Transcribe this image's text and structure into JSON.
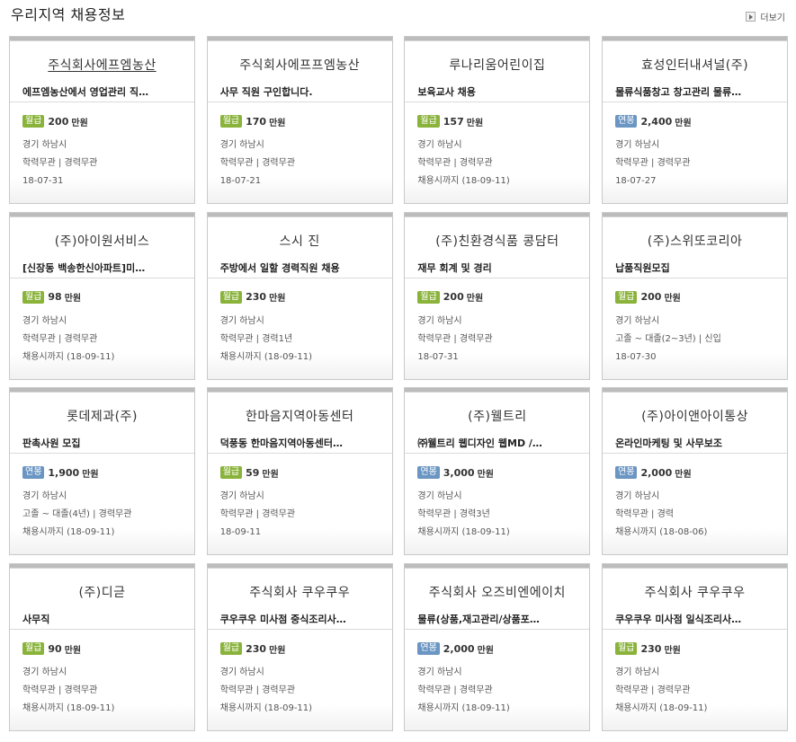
{
  "header": {
    "title": "우리지역 채용정보",
    "more_label": "더보기"
  },
  "colors": {
    "monthly_badge": "#8ab33b",
    "yearly_badge": "#6b96c3"
  },
  "cards": [
    {
      "company": "주식회사에프엠농산",
      "title": "에프엠농산에서 영업관리 직…",
      "pay_type": "월급",
      "pay_kind": "monthly",
      "amount": "200",
      "unit": "만원",
      "location": "경기 하남시",
      "requirements": "학력무관 | 경력무관",
      "deadline": "18-07-31"
    },
    {
      "company": "주식회사에프프엠농산",
      "title": "사무 직원 구인합니다.",
      "pay_type": "월급",
      "pay_kind": "monthly",
      "amount": "170",
      "unit": "만원",
      "location": "경기 하남시",
      "requirements": "학력무관 | 경력무관",
      "deadline": "18-07-21"
    },
    {
      "company": "루나리움어린이집",
      "title": "보육교사 채용",
      "pay_type": "월급",
      "pay_kind": "monthly",
      "amount": "157",
      "unit": "만원",
      "location": "경기 하남시",
      "requirements": "학력무관 | 경력무관",
      "deadline": "채용시까지 (18-09-11)"
    },
    {
      "company": "효성인터내셔널(주)",
      "title": "물류식품창고 창고관리 물류…",
      "pay_type": "연봉",
      "pay_kind": "yearly",
      "amount": "2,400",
      "unit": "만원",
      "location": "경기 하남시",
      "requirements": "학력무관 | 경력무관",
      "deadline": "18-07-27"
    },
    {
      "company": "(주)아이원서비스",
      "title": "[신장동 백송한신아파트]미…",
      "pay_type": "월급",
      "pay_kind": "monthly",
      "amount": "98",
      "unit": "만원",
      "location": "경기 하남시",
      "requirements": "학력무관 | 경력무관",
      "deadline": "채용시까지 (18-09-11)"
    },
    {
      "company": "스시 진",
      "title": "주방에서 일할 경력직원 채용",
      "pay_type": "월급",
      "pay_kind": "monthly",
      "amount": "230",
      "unit": "만원",
      "location": "경기 하남시",
      "requirements": "학력무관 | 경력1년",
      "deadline": "채용시까지 (18-09-11)"
    },
    {
      "company": "(주)친환경식품 콩담터",
      "title": "재무 회계 및 경리",
      "pay_type": "월급",
      "pay_kind": "monthly",
      "amount": "200",
      "unit": "만원",
      "location": "경기 하남시",
      "requirements": "학력무관 | 경력무관",
      "deadline": "18-07-31"
    },
    {
      "company": "(주)스위또코리아",
      "title": "납품직원모집",
      "pay_type": "월급",
      "pay_kind": "monthly",
      "amount": "200",
      "unit": "만원",
      "location": "경기 하남시",
      "requirements": "고졸 ~ 대졸(2~3년) | 신입",
      "deadline": "18-07-30"
    },
    {
      "company": "롯데제과(주)",
      "title": "판촉사원 모집",
      "pay_type": "연봉",
      "pay_kind": "yearly",
      "amount": "1,900",
      "unit": "만원",
      "location": "경기 하남시",
      "requirements": "고졸 ~ 대졸(4년) | 경력무관",
      "deadline": "채용시까지 (18-09-11)"
    },
    {
      "company": "한마음지역아동센터",
      "title": "덕풍동 한마음지역아동센터…",
      "pay_type": "월급",
      "pay_kind": "monthly",
      "amount": "59",
      "unit": "만원",
      "location": "경기 하남시",
      "requirements": "학력무관 | 경력무관",
      "deadline": "18-09-11"
    },
    {
      "company": "(주)웰트리",
      "title": "㈜웰트리 웹디자인 웹MD /…",
      "pay_type": "연봉",
      "pay_kind": "yearly",
      "amount": "3,000",
      "unit": "만원",
      "location": "경기 하남시",
      "requirements": "학력무관 | 경력3년",
      "deadline": "채용시까지 (18-09-11)"
    },
    {
      "company": "(주)아이앤아이통상",
      "title": "온라인마케팅 및 사무보조",
      "pay_type": "연봉",
      "pay_kind": "yearly",
      "amount": "2,000",
      "unit": "만원",
      "location": "경기 하남시",
      "requirements": "학력무관 | 경력",
      "deadline": "채용시까지 (18-08-06)"
    },
    {
      "company": "(주)디귿",
      "title": "사무직",
      "pay_type": "월급",
      "pay_kind": "monthly",
      "amount": "90",
      "unit": "만원",
      "location": "경기 하남시",
      "requirements": "학력무관 | 경력무관",
      "deadline": "채용시까지 (18-09-11)"
    },
    {
      "company": "주식회사 쿠우쿠우",
      "title": "쿠우쿠우 미사점 중식조리사…",
      "pay_type": "월급",
      "pay_kind": "monthly",
      "amount": "230",
      "unit": "만원",
      "location": "경기 하남시",
      "requirements": "학력무관 | 경력무관",
      "deadline": "채용시까지 (18-09-11)"
    },
    {
      "company": "주식회사 오즈비엔에이치",
      "title": "물류(상품,재고관리/상품포…",
      "pay_type": "연봉",
      "pay_kind": "yearly",
      "amount": "2,000",
      "unit": "만원",
      "location": "경기 하남시",
      "requirements": "학력무관 | 경력무관",
      "deadline": "채용시까지 (18-09-11)"
    },
    {
      "company": "주식회사 쿠우쿠우",
      "title": "쿠우쿠우 미사점 일식조리사…",
      "pay_type": "월급",
      "pay_kind": "monthly",
      "amount": "230",
      "unit": "만원",
      "location": "경기 하남시",
      "requirements": "학력무관 | 경력무관",
      "deadline": "채용시까지 (18-09-11)"
    }
  ]
}
